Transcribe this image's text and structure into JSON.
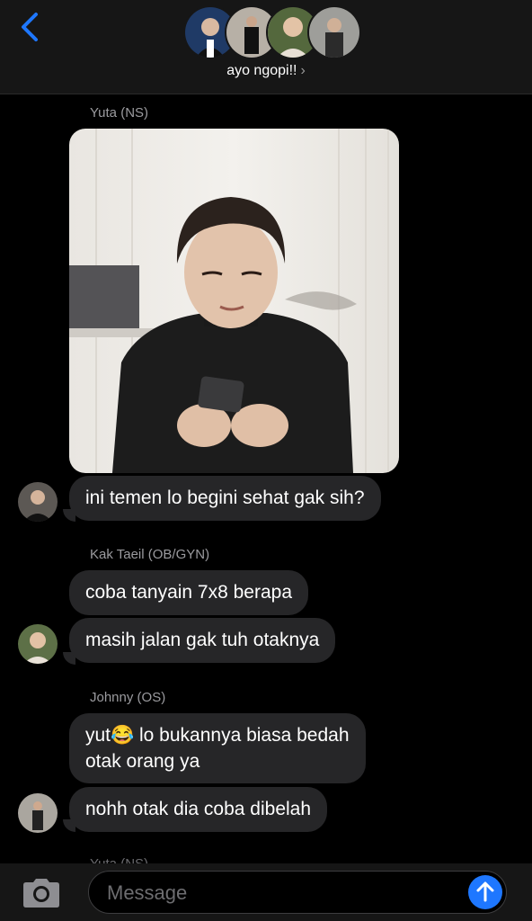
{
  "header": {
    "title": "ayo ngopi!!",
    "chevron": "›"
  },
  "messages": [
    {
      "sender": "Yuta (NS)",
      "type": "image",
      "content": "photo of man in black sweater holding phone"
    },
    {
      "type": "text",
      "text": "ini temen lo begini sehat gak sih?"
    },
    {
      "sender": "Kak Taeil (OB/GYN)",
      "type": "text",
      "text": "coba tanyain 7x8 berapa"
    },
    {
      "type": "text",
      "text": "masih jalan gak tuh otaknya"
    },
    {
      "sender": "Johnny (OS)",
      "type": "text",
      "line1": "yut😂 lo bukannya biasa bedah",
      "line2": "otak orang ya"
    },
    {
      "type": "text",
      "text": "nohh otak dia coba dibelah"
    }
  ],
  "partial_sender": "Yuta (NS)",
  "composer": {
    "placeholder": "Message"
  },
  "colors": {
    "accent": "#1e77ff",
    "bubble": "#262628",
    "background": "#000000"
  },
  "icons": [
    "back-chevron-icon",
    "camera-icon",
    "send-arrow-icon"
  ]
}
